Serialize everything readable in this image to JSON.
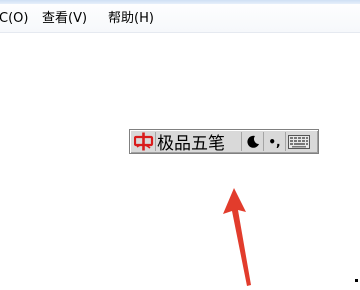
{
  "menu": {
    "format": "C(O)",
    "view": "查看(V)",
    "help": "帮助(H)"
  },
  "ime": {
    "name": "极品五笔",
    "logo_char": "中",
    "punct": "•,"
  },
  "colors": {
    "arrow": "#e23c2c",
    "logo": "#d91c1c"
  }
}
